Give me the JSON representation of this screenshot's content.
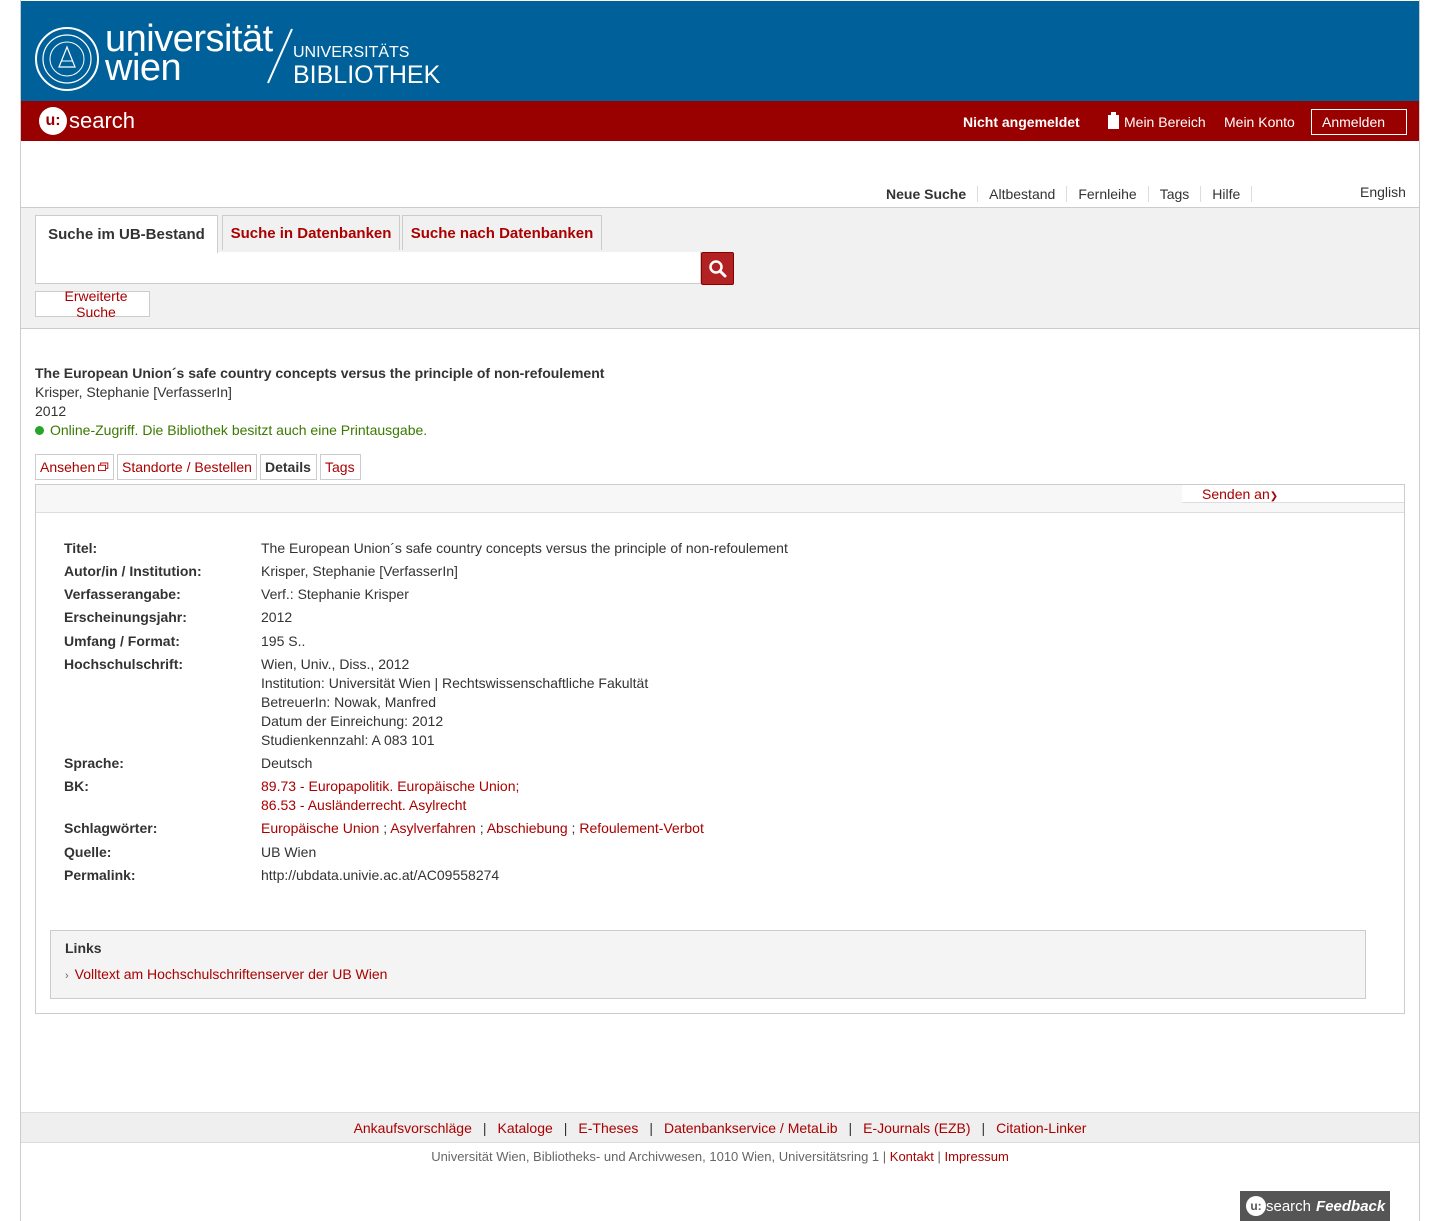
{
  "header": {
    "uni_name_line1": "universität",
    "uni_name_line2": "wien",
    "ub_line1": "UNIVERSITÄTS",
    "ub_line2": "BIBLIOTHEK"
  },
  "userbar": {
    "logo_u": "u:",
    "logo_text": "search",
    "status": "Nicht angemeldet",
    "mein_bereich": "Mein Bereich",
    "mein_konto": "Mein Konto",
    "login": "Anmelden"
  },
  "topnav": {
    "items": [
      "Neue Suche",
      "Altbestand",
      "Fernleihe",
      "Tags",
      "Hilfe"
    ],
    "language": "English"
  },
  "search": {
    "tabs": [
      "Suche im UB-Bestand",
      "Suche in Datenbanken",
      "Suche nach Datenbanken"
    ],
    "query": "",
    "advanced": "Erweiterte Suche"
  },
  "record": {
    "title": "The European Union´s safe country concepts versus the principle of non-refoulement",
    "author": "Krisper, Stephanie [VerfasserIn]",
    "year": "2012",
    "availability": "Online-Zugriff. Die Bibliothek besitzt auch eine Printausgabe.",
    "tabs": [
      "Ansehen",
      "Standorte / Bestellen",
      "Details",
      "Tags"
    ],
    "send_to": "Senden an"
  },
  "details": {
    "titel_label": "Titel:",
    "titel": "The European Union´s safe country concepts versus the principle of non-refoulement",
    "autor_label": "Autor/in / Institution:",
    "autor": "Krisper, Stephanie [VerfasserIn]",
    "verf_label": "Verfasserangabe:",
    "verf": "Verf.: Stephanie Krisper",
    "jahr_label": "Erscheinungsjahr:",
    "jahr": "2012",
    "umfang_label": "Umfang / Format:",
    "umfang": "195 S..",
    "hs_label": "Hochschulschrift:",
    "hs_lines": [
      "Wien, Univ., Diss., 2012",
      "Institution: Universität Wien | Rechtswissenschaftliche Fakultät",
      "BetreuerIn: Nowak, Manfred",
      "Datum der Einreichung: 2012",
      "Studienkennzahl: A 083 101"
    ],
    "sprache_label": "Sprache:",
    "sprache": "Deutsch",
    "bk_label": "BK:",
    "bk": [
      "89.73 - Europapolitik. Europäische Union;",
      "86.53 - Ausländerrecht. Asylrecht"
    ],
    "schlag_label": "Schlagwörter:",
    "schlag": [
      "Europäische Union",
      "Asylverfahren",
      "Abschiebung",
      "Refoulement-Verbot"
    ],
    "schlag_sep": ";",
    "quelle_label": "Quelle:",
    "quelle": "UB Wien",
    "perma_label": "Permalink:",
    "perma": "http://ubdata.univie.ac.at/AC09558274"
  },
  "links": {
    "title": "Links",
    "item": "Volltext am Hochschulschriftenserver der UB Wien"
  },
  "footer": {
    "links": [
      "Ankaufsvorschläge",
      "Kataloge",
      "E-Theses",
      "Datenbankservice / MetaLib",
      "E-Journals (EZB)",
      "Citation-Linker"
    ],
    "pipe": "|",
    "address": "Universität Wien, Bibliotheks- und Archivwesen, 1010 Wien, Universitätsring 1 |",
    "kontakt": "Kontakt",
    "impressum": "Impressum",
    "feedback_u": "u:",
    "feedback_search": "search",
    "feedback_label": "Feedback"
  },
  "colors": {
    "header_blue": "#00609a",
    "bar_red": "#990000",
    "link_red": "#aa0000",
    "available_green": "#3a7a00"
  }
}
